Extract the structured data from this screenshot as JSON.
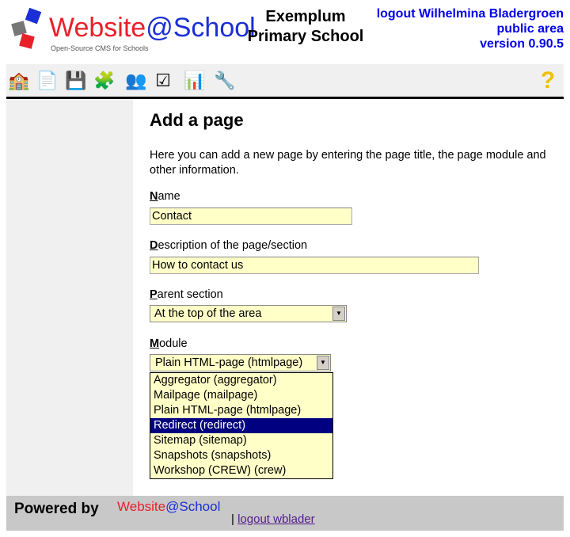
{
  "header": {
    "logo_text": "Website@School",
    "logo_tagline": "Open-Source CMS for Schools",
    "school_line1": "Exemplum",
    "school_line2": "Primary School",
    "logout_label": "logout Wilhelmina Bladergroen",
    "area": "public area",
    "version": "version 0.90.5"
  },
  "toolbar": {
    "icons": [
      "home-icon",
      "page-icon",
      "save-icon",
      "modules-icon",
      "users-icon",
      "checklist-icon",
      "statistics-icon",
      "tools-icon"
    ],
    "help_icon": "help-icon"
  },
  "main": {
    "title": "Add a page",
    "intro": "Here you can add a new page by entering the page title, the page module and other information.",
    "name_label_key": "N",
    "name_label_rest": "ame",
    "name_value": "Contact",
    "desc_label_key": "D",
    "desc_label_rest": "escription of the page/section",
    "desc_value": "How to contact us",
    "parent_label_key": "P",
    "parent_label_rest": "arent section",
    "parent_value": "At the top of the area",
    "module_label_key": "M",
    "module_label_rest": "odule",
    "module_value": "Plain HTML-page (htmlpage)",
    "module_options": [
      "Aggregator (aggregator)",
      "Mailpage (mailpage)",
      "Plain HTML-page (htmlpage)",
      "Redirect (redirect)",
      "Sitemap (sitemap)",
      "Snapshots (snapshots)",
      "Workshop (CREW) (crew)"
    ],
    "highlighted_option": "Redirect (redirect)"
  },
  "footer": {
    "powered_by": "Powered by",
    "logo_text": "Website@School",
    "separator": "|",
    "logout_link": "logout wblader"
  },
  "colors": {
    "input_bg": "#ffffc8",
    "highlight": "#000080",
    "link": "#0000ee",
    "footer_bg": "#c8c8c8"
  }
}
